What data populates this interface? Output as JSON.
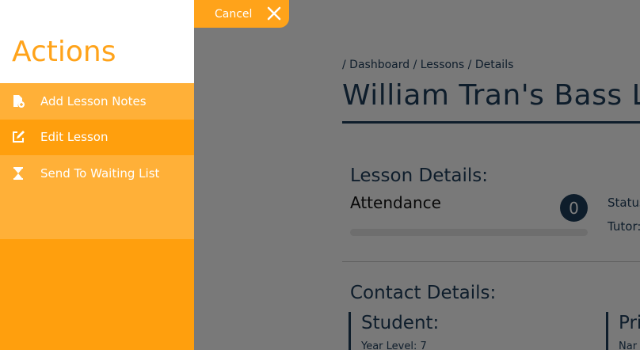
{
  "panel": {
    "title": "Actions",
    "items": [
      {
        "label": "Add Lesson Notes",
        "icon": "file-add-icon"
      },
      {
        "label": "Edit Lesson",
        "icon": "edit-icon"
      },
      {
        "label": "Send To Waiting List",
        "icon": "hourglass-icon"
      }
    ],
    "cancel_label": "Cancel"
  },
  "page": {
    "breadcrumb": "/ Dashboard / Lessons / Details",
    "title": "William Tran's Bass Les",
    "lesson_details_title": "Lesson Details:",
    "attendance_label": "Attendance",
    "attendance_count": "0",
    "attendance_progress": 0,
    "status_label": "Status",
    "tutor_label": "Tutor:",
    "contact_details_title": "Contact Details:",
    "student_title": "Student:",
    "year_level_label": "Year Level:",
    "year_level_value": "7",
    "primary_title": "Pri",
    "name_label": "Nar"
  },
  "colors": {
    "accent_orange": "#ff9f0d",
    "menu_light_orange": "#ffb038",
    "navy": "#1d3a57"
  }
}
